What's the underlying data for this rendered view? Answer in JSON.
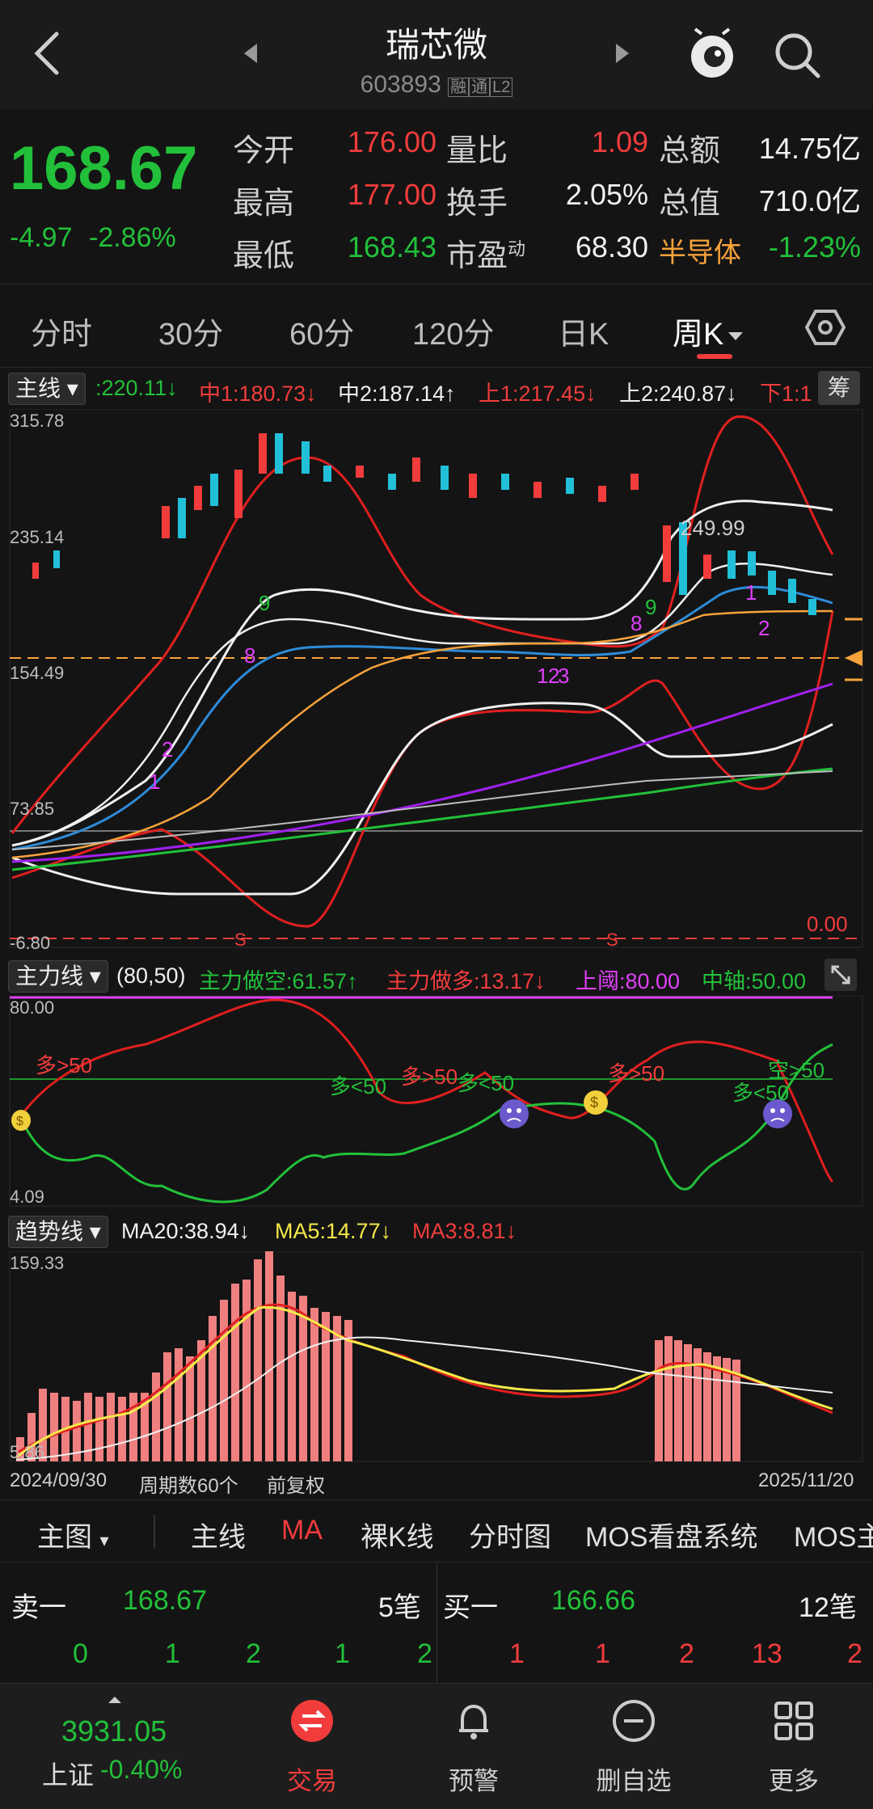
{
  "header": {
    "title": "瑞芯微",
    "code": "603893",
    "badges": [
      "融",
      "通",
      "L2"
    ]
  },
  "quote": {
    "price": "168.67",
    "change": "-4.97",
    "change_pct": "-2.86%",
    "rows": [
      [
        {
          "label": "今开",
          "value": "176.00",
          "color": "red"
        },
        {
          "label": "量比",
          "value": "1.09",
          "color": "red"
        },
        {
          "label": "总额",
          "value": "14.75亿",
          "color": "white"
        }
      ],
      [
        {
          "label": "最高",
          "value": "177.00",
          "color": "red"
        },
        {
          "label": "换手",
          "value": "2.05%",
          "color": "white"
        },
        {
          "label": "总值",
          "value": "710.0亿",
          "color": "white"
        }
      ],
      [
        {
          "label": "最低",
          "value": "168.43",
          "color": "green"
        },
        {
          "label": "市盈",
          "value": "68.30",
          "color": "white"
        },
        {
          "label": "半导体",
          "value": "-1.23%",
          "color": "green"
        }
      ]
    ],
    "pe_sup": "动"
  },
  "tabs": [
    "分时",
    "30分",
    "60分",
    "120分",
    "日K",
    "周K"
  ],
  "active_tab": "周K",
  "main_indicator": {
    "selector": "主线",
    "values": [
      ":220.11↓",
      "中1:180.73↓",
      "中2:187.14↑",
      "上1:217.45↓",
      "上2:240.87↓",
      "下1:1"
    ],
    "side_btn": "筹",
    "y_labels": [
      "315.78",
      "235.14",
      "154.49",
      "73.85",
      "-6.80"
    ],
    "right_label": "0.00",
    "peak_label": "249.99",
    "seq_labels": [
      "9",
      "8",
      "9",
      "8",
      "2",
      "1",
      "1",
      "2",
      "3",
      "1",
      "2"
    ]
  },
  "power_indicator": {
    "selector": "主力线",
    "params": "(80,50)",
    "values": [
      {
        "t": "主力做空:61.57↑",
        "c": "green"
      },
      {
        "t": "主力做多:13.17↓",
        "c": "red"
      },
      {
        "t": "上阈:80.00",
        "c": "magenta"
      },
      {
        "t": "中轴:50.00",
        "c": "green"
      }
    ],
    "y_top": "80.00",
    "y_bottom": "4.09",
    "annotations": [
      "多>50",
      "多<50",
      "多>50",
      "多<50",
      "多>50",
      "多<50",
      "空>50"
    ]
  },
  "trend_indicator": {
    "selector": "趋势线",
    "values": [
      {
        "t": "MA20:38.94↓",
        "c": "white"
      },
      {
        "t": "MA5:14.77↓",
        "c": "yellow"
      },
      {
        "t": "MA3:8.81↓",
        "c": "red"
      }
    ],
    "y_top": "159.33",
    "y_bottom": "5.86"
  },
  "date_bar": {
    "start": "2024/09/30",
    "periods": "周期数60个",
    "adjust": "前复权",
    "end": "2025/11/20"
  },
  "bottom_tabs": [
    "主图",
    "主线",
    "MA",
    "裸K线",
    "分时图",
    "MOS看盘系统",
    "MOS主"
  ],
  "orderbook": {
    "sell_label": "卖一",
    "sell_price": "168.67",
    "sell_count": "5笔",
    "buy_label": "买一",
    "buy_price": "166.66",
    "buy_count": "12笔",
    "sell_qty": [
      "0",
      "1",
      "2",
      "1",
      "2"
    ],
    "buy_qty": [
      "1",
      "1",
      "2",
      "13",
      "2"
    ]
  },
  "nav": {
    "index_value": "3931.05",
    "index_name": "上证",
    "index_change": "-0.40%",
    "items": [
      {
        "label": "交易"
      },
      {
        "label": "预警"
      },
      {
        "label": "删自选"
      },
      {
        "label": "更多"
      }
    ]
  },
  "colors": {
    "up": "#f23c3c",
    "down": "#22c03a",
    "accent": "#f23c3c",
    "bg": "#141414"
  }
}
